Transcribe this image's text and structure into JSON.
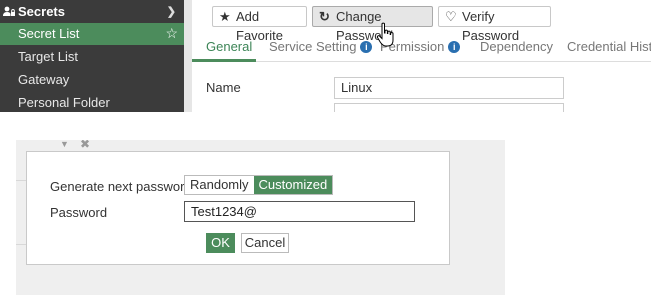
{
  "sidebar": {
    "header": "Secrets",
    "items": [
      {
        "label": "Secret List",
        "active": true
      },
      {
        "label": "Target List",
        "active": false
      },
      {
        "label": "Gateway",
        "active": false
      },
      {
        "label": "Personal Folder",
        "active": false
      }
    ]
  },
  "toolbar": {
    "add_favorite": "Add Favorite",
    "change_password": "Change Password",
    "verify_password": "Verify Password"
  },
  "tabs": [
    {
      "label": "General",
      "active": true
    },
    {
      "label": "Service Setting",
      "info": true
    },
    {
      "label": "Permission",
      "info": true
    },
    {
      "label": "Dependency"
    },
    {
      "label": "Credential Hist"
    }
  ],
  "form": {
    "name_label": "Name",
    "name_value": "Linux"
  },
  "dialog": {
    "generate_label": "Generate next password",
    "options": [
      "Randomly",
      "Customized"
    ],
    "selected_option": "Customized",
    "password_label": "Password",
    "password_value": "Test1234@",
    "ok": "OK",
    "cancel": "Cancel"
  },
  "colors": {
    "accent": "#4c8c5c",
    "sidebar_bg": "#3b3b3b",
    "info": "#2a6fb0"
  }
}
